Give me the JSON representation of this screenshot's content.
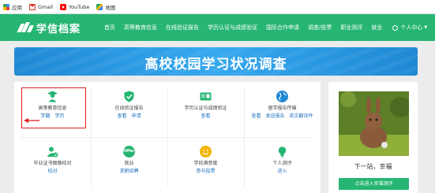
{
  "bookmarks": [
    {
      "label": "应用",
      "icon": "apps-icon"
    },
    {
      "label": "Gmail",
      "icon": "gmail-icon"
    },
    {
      "label": "YouTube",
      "icon": "youtube-icon"
    },
    {
      "label": "地图",
      "icon": "maps-icon"
    }
  ],
  "header": {
    "logo_text": "学信档案",
    "nav": [
      "首页",
      "高等教育信息",
      "在线验证报告",
      "学历认证与成绩验证",
      "国际合作申请",
      "调查/投票",
      "职业测评",
      "就业"
    ],
    "user_menu": "个人中心",
    "accent": "#26b572"
  },
  "banner": {
    "title": "高校校园学习状况调查",
    "color": "#2196e6"
  },
  "services": [
    {
      "title": "高等教育信息",
      "links": [
        "学籍",
        "学历"
      ],
      "icon": "graduate-icon"
    },
    {
      "title": "在线验证报告",
      "links": [
        "查看",
        "申请"
      ],
      "icon": "shield-check-icon"
    },
    {
      "title": "学历认证与成绩验证",
      "links": [
        "查看"
      ],
      "icon": "certificate-icon"
    },
    {
      "title": "留学报告传输",
      "links": [
        "查看",
        "发送报告",
        "英文翻译件"
      ],
      "icon": "globe-icon"
    },
    {
      "title": "毕业证书图像校对",
      "links": [
        "校对"
      ],
      "icon": "user-check-icon"
    },
    {
      "title": "就业",
      "links": [
        "求职招聘"
      ],
      "icon": "offer-icon"
    },
    {
      "title": "学校满意度",
      "links": [
        "参与投票"
      ],
      "icon": "smiley-icon"
    },
    {
      "title": "个人测评",
      "links": [
        "进入"
      ],
      "icon": "lightbulb-icon"
    }
  ],
  "side": {
    "photo": "rabbit-photo",
    "caption": "下一站，幸福",
    "button_label": "点击进入幸福测评"
  },
  "link_color": "#1b6fbf",
  "highlight_color": "#e02020"
}
